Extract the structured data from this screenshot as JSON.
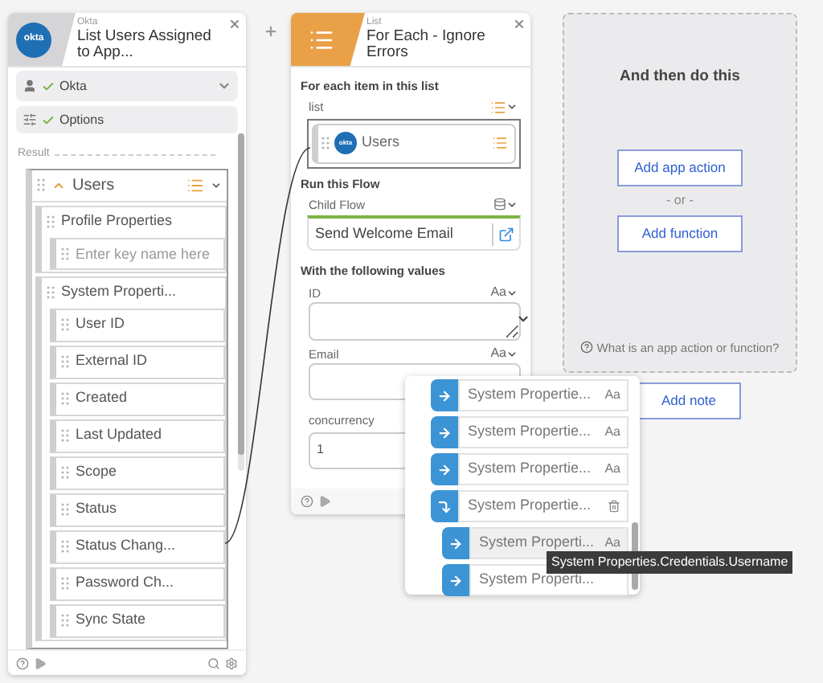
{
  "okta_card": {
    "logo_text": "okta",
    "app_label": "Okta",
    "title": "List Users Assigned to App...",
    "connection": {
      "label": "Okta",
      "checked": true
    },
    "options": {
      "label": "Options",
      "checked": true
    },
    "result_label": "Result",
    "tree": {
      "label": "Users",
      "expanded": true,
      "children": [
        {
          "label": "Profile Properties",
          "children": [
            {
              "kind": "input",
              "placeholder": "Enter key name here"
            }
          ]
        },
        {
          "label": "System Properti...",
          "children": [
            {
              "label": "User ID"
            },
            {
              "label": "External ID"
            },
            {
              "label": "Created"
            },
            {
              "label": "Last Updated"
            },
            {
              "label": "Scope"
            },
            {
              "label": "Status"
            },
            {
              "label": "Status Chang..."
            },
            {
              "label": "Password Ch..."
            },
            {
              "label": "Sync State"
            }
          ]
        }
      ]
    }
  },
  "list_card": {
    "category": "List",
    "title": "For Each - Ignore Errors",
    "section_list": "For each item in this list",
    "list_field": {
      "label": "list",
      "value": "Users",
      "logo_text": "okta"
    },
    "section_flow": "Run this Flow",
    "child_flow": {
      "label": "Child Flow",
      "value": "Send Welcome Email"
    },
    "section_values": "With the following values",
    "fields": [
      {
        "label": "ID",
        "type_label": "Aa",
        "kind": "textarea"
      },
      {
        "label": "Email",
        "type_label": "Aa",
        "kind": "input"
      }
    ],
    "concurrency": {
      "label": "concurrency",
      "value": "1"
    }
  },
  "next_step": {
    "title": "And then do this",
    "buttons": [
      "Add app action",
      "Add function"
    ],
    "separator": "- or -",
    "help": "What is an app action or function?"
  },
  "add_note": "Add note",
  "dropdown": {
    "items": [
      {
        "label": "System Propertie...",
        "type_label": "Aa",
        "kind": "field",
        "selected": false
      },
      {
        "label": "System Propertie...",
        "type_label": "Aa",
        "kind": "field",
        "selected": false
      },
      {
        "label": "System Propertie...",
        "type_label": "Aa",
        "kind": "field",
        "selected": false
      },
      {
        "label": "System Propertie...",
        "kind": "object",
        "selected": false,
        "children": [
          {
            "label": "System Properti...",
            "type_label": "Aa",
            "kind": "field",
            "selected": true
          },
          {
            "label": "System Properti...",
            "kind": "field",
            "selected": false
          }
        ]
      }
    ]
  },
  "tooltip": "System Properties.Credentials.Username"
}
